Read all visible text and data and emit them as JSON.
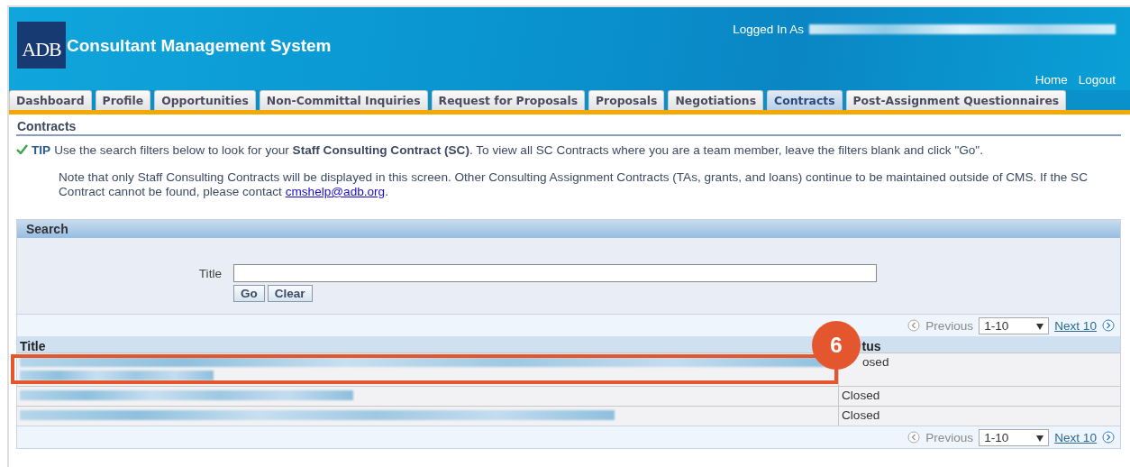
{
  "header": {
    "logo": "ADB",
    "title": "Consultant Management System",
    "logged_in_label": "Logged In As",
    "links": [
      "Home",
      "Logout"
    ]
  },
  "tabs": [
    {
      "label": "Dashboard",
      "selected": false
    },
    {
      "label": "Profile",
      "selected": false
    },
    {
      "label": "Opportunities",
      "selected": false
    },
    {
      "label": "Non-Committal Inquiries",
      "selected": false
    },
    {
      "label": "Request for Proposals",
      "selected": false
    },
    {
      "label": "Proposals",
      "selected": false
    },
    {
      "label": "Negotiations",
      "selected": false
    },
    {
      "label": "Contracts",
      "selected": true
    },
    {
      "label": "Post-Assignment Questionnaires",
      "selected": false
    }
  ],
  "page_title": "Contracts",
  "tip": {
    "label": "TIP",
    "text": "Use the search filters below to look for your **Staff Consulting Contract (SC)**. To view all SC Contracts where you are a team member, leave the filters blank and click \"Go\".",
    "note": "Note that only Staff Consulting Contracts will be displayed in this screen. Other Consulting Assignment Contracts (TAs, grants, and loans) continue to be maintained outside of CMS. If the SC Contract cannot be found, please contact ",
    "email": "cmshelp@adb.org",
    "note_end": "."
  },
  "search": {
    "title": "Search",
    "field_label": "Title",
    "buttons": [
      "Go",
      "Clear"
    ]
  },
  "pagination": [
    {
      "previous": "Previous",
      "range": "1-10",
      "next": "Next 10"
    },
    {
      "previous": "Previous",
      "range": "1-10",
      "next": "Next 10"
    }
  ],
  "table": {
    "columns": [
      "Title",
      "tus"
    ],
    "rows": [
      {
        "status": "osed",
        "annotated": true
      },
      {
        "status": "Closed",
        "annotated": false
      },
      {
        "status": "Closed",
        "annotated": false
      }
    ]
  },
  "callout": {
    "number": "6"
  }
}
